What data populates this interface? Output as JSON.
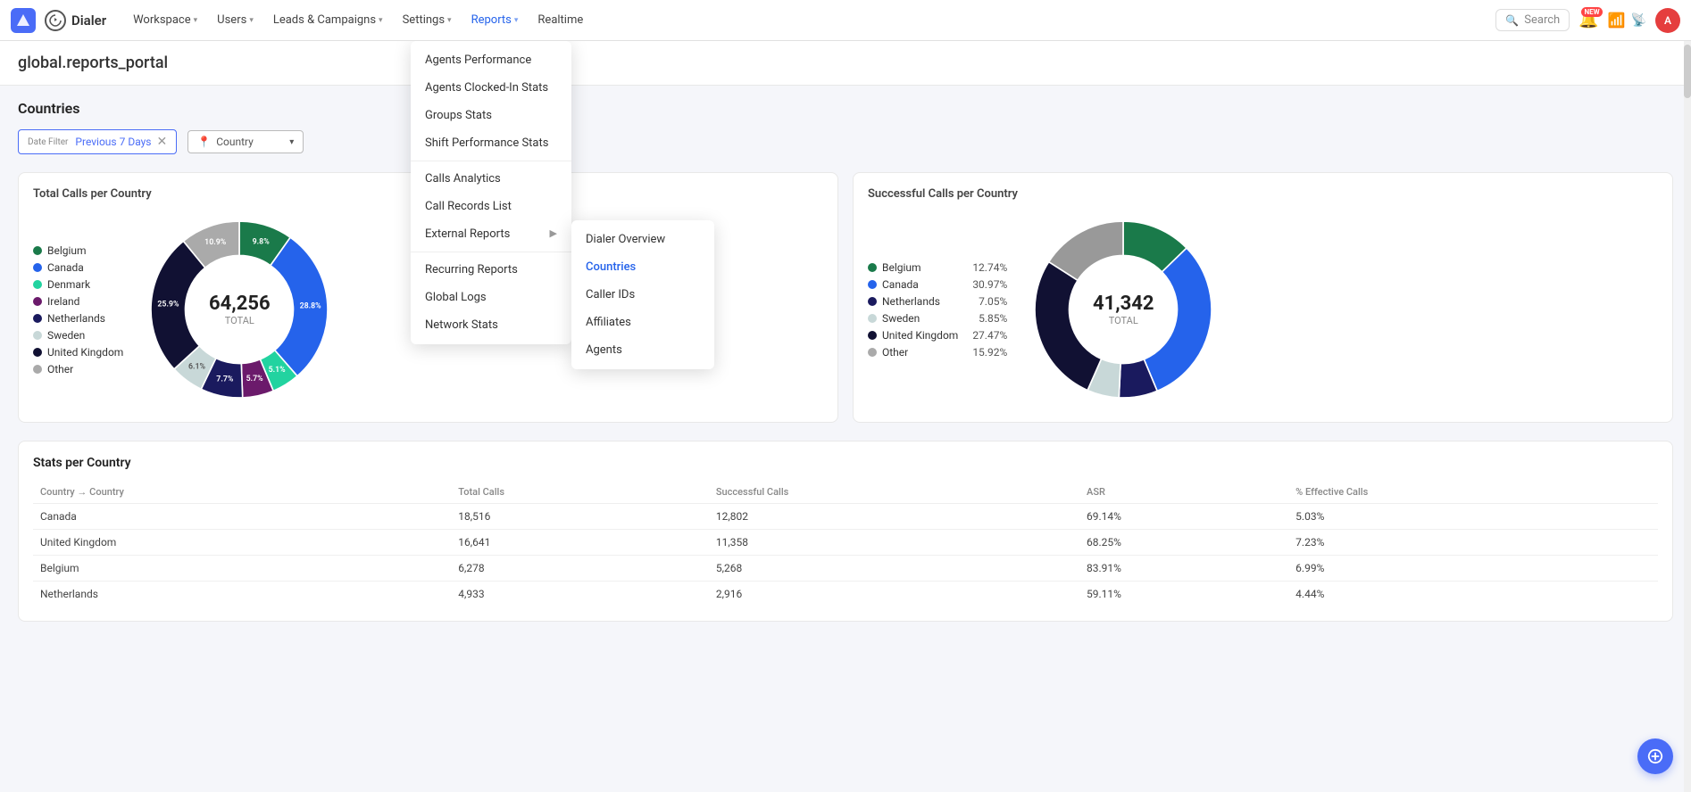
{
  "app": {
    "name": "Dialer",
    "logo_text": "A"
  },
  "navbar": {
    "title": "global.reports_portal",
    "workspace_label": "Workspace",
    "nav_items": [
      {
        "label": "Workspace",
        "has_dropdown": true
      },
      {
        "label": "Users",
        "has_dropdown": true
      },
      {
        "label": "Leads & Campaigns",
        "has_dropdown": true
      },
      {
        "label": "Settings",
        "has_dropdown": true
      },
      {
        "label": "Reports",
        "has_dropdown": true,
        "active": true
      },
      {
        "label": "Realtime",
        "has_dropdown": false
      }
    ],
    "search_placeholder": "Search",
    "avatar_letter": "A"
  },
  "reports_menu": {
    "items": [
      {
        "label": "Agents Performance"
      },
      {
        "label": "Agents Clocked-In Stats"
      },
      {
        "label": "Groups Stats"
      },
      {
        "label": "Shift Performance Stats"
      },
      {
        "divider": true
      },
      {
        "label": "Calls Analytics"
      },
      {
        "label": "Call Records List"
      },
      {
        "label": "External Reports",
        "has_submenu": true
      },
      {
        "divider": true
      },
      {
        "label": "Recurring Reports"
      },
      {
        "label": "Global Logs"
      },
      {
        "label": "Network Stats"
      }
    ],
    "external_submenu": [
      {
        "label": "Dialer Overview"
      },
      {
        "label": "Countries",
        "active": true
      },
      {
        "label": "Caller IDs"
      },
      {
        "label": "Affiliates"
      },
      {
        "label": "Agents"
      }
    ]
  },
  "page": {
    "section_title": "Countries",
    "date_filter_label": "Date Filter",
    "date_filter_value": "Previous 7 Days",
    "country_filter_label": "Country",
    "country_filter_placeholder": "Country"
  },
  "total_calls_chart": {
    "title": "Total Calls per Country",
    "total": "64,256",
    "total_label": "TOTAL",
    "legend": [
      {
        "label": "Belgium",
        "color": "#1a7a4a",
        "pct": ""
      },
      {
        "label": "Canada",
        "color": "#2563eb",
        "pct": ""
      },
      {
        "label": "Denmark",
        "color": "#22d3a0",
        "pct": ""
      },
      {
        "label": "Ireland",
        "color": "#6b1a6b",
        "pct": ""
      },
      {
        "label": "Netherlands",
        "color": "#1a1a5e",
        "pct": ""
      },
      {
        "label": "Sweden",
        "color": "#c8d8d8",
        "pct": ""
      },
      {
        "label": "United Kingdom",
        "color": "#111133",
        "pct": ""
      },
      {
        "label": "Other",
        "color": "#999",
        "pct": ""
      }
    ],
    "segments": [
      {
        "color": "#1a7a4a",
        "pct": 9.8,
        "label": "9.8%"
      },
      {
        "color": "#2563eb",
        "pct": 28.8,
        "label": "28.8%"
      },
      {
        "color": "#22d3a0",
        "pct": 5.1,
        "label": "5.1%"
      },
      {
        "color": "#6b1a6b",
        "pct": 5.7,
        "label": "5.7%"
      },
      {
        "color": "#1a1a5e",
        "pct": 7.7,
        "label": "7.7%"
      },
      {
        "color": "#c8d8d8",
        "pct": 6.1,
        "label": "6.1%"
      },
      {
        "color": "#111133",
        "pct": 25.9,
        "label": "25.9%"
      },
      {
        "color": "#aaa",
        "pct": 10.9,
        "label": "10.9%"
      }
    ]
  },
  "successful_calls_chart": {
    "title": "Successful Calls per Country",
    "total": "41,342",
    "total_label": "TOTAL",
    "legend": [
      {
        "label": "Belgium",
        "color": "#1a7a4a",
        "pct": "12.74%"
      },
      {
        "label": "Canada",
        "color": "#2563eb",
        "pct": "30.97%"
      },
      {
        "label": "Netherlands",
        "color": "#1a1a5e",
        "pct": "7.05%"
      },
      {
        "label": "Sweden",
        "color": "#c8d8d8",
        "pct": "5.85%"
      },
      {
        "label": "United Kingdom",
        "color": "#111133",
        "pct": "27.47%"
      },
      {
        "label": "Other",
        "color": "#999",
        "pct": "15.92%"
      }
    ],
    "segments": [
      {
        "color": "#1a7a4a",
        "pct": 12.74
      },
      {
        "color": "#2563eb",
        "pct": 30.97
      },
      {
        "color": "#1a1a5e",
        "pct": 7.05
      },
      {
        "color": "#c8d8d8",
        "pct": 5.85
      },
      {
        "color": "#111133",
        "pct": 27.47
      },
      {
        "color": "#999",
        "pct": 15.92
      }
    ]
  },
  "stats_table": {
    "title": "Stats per Country",
    "columns": [
      "Country → Country",
      "Total Calls",
      "Successful Calls",
      "ASR",
      "% Effective Calls"
    ],
    "rows": [
      {
        "country": "Canada",
        "total_calls": "18,516",
        "successful_calls": "12,802",
        "asr": "69.14%",
        "effective": "5.03%"
      },
      {
        "country": "United Kingdom",
        "total_calls": "16,641",
        "successful_calls": "11,358",
        "asr": "68.25%",
        "effective": "7.23%"
      },
      {
        "country": "Belgium",
        "total_calls": "6,278",
        "successful_calls": "5,268",
        "asr": "83.91%",
        "effective": "6.99%"
      },
      {
        "country": "Netherlands",
        "total_calls": "4,933",
        "successful_calls": "2,916",
        "asr": "59.11%",
        "effective": "4.44%"
      }
    ]
  }
}
